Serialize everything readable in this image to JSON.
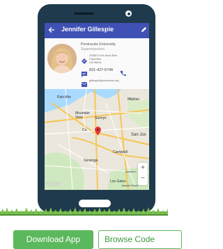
{
  "contact": {
    "name": "Jennifer Gillespie",
    "organization": "Peninsula University",
    "role": "Superintendent",
    "address_line1": "19382 N De Anza Blvd",
    "address_line2": "Cupertino",
    "address_line3": "CA 95014",
    "phone": "831-427-6746",
    "email": "gillespie@peninsula.org"
  },
  "map": {
    "labels": {
      "palo_alto": "Palo Alto",
      "mountain_view": "Mountain View",
      "milpitas": "Milpitas",
      "san_jose": "San Jos",
      "campbell": "Campbell",
      "saratoga": "Saratoga",
      "los_gatos": "Los Gatos",
      "almaden": "Almaden",
      "joseph_grant": "Joseph Grant",
      "cupertino_short": "Cu",
      "sunnyvale_short": "Sunnyv"
    },
    "zoom_in": "+",
    "zoom_out": "−",
    "attribution": "Google"
  },
  "buttons": {
    "download": "Download App",
    "browse": "Browse Code"
  },
  "colors": {
    "appbar": "#3f51b5",
    "phone_body": "#1f3a4c",
    "accent_green": "#5cb85c",
    "map_pin": "#e53935"
  }
}
